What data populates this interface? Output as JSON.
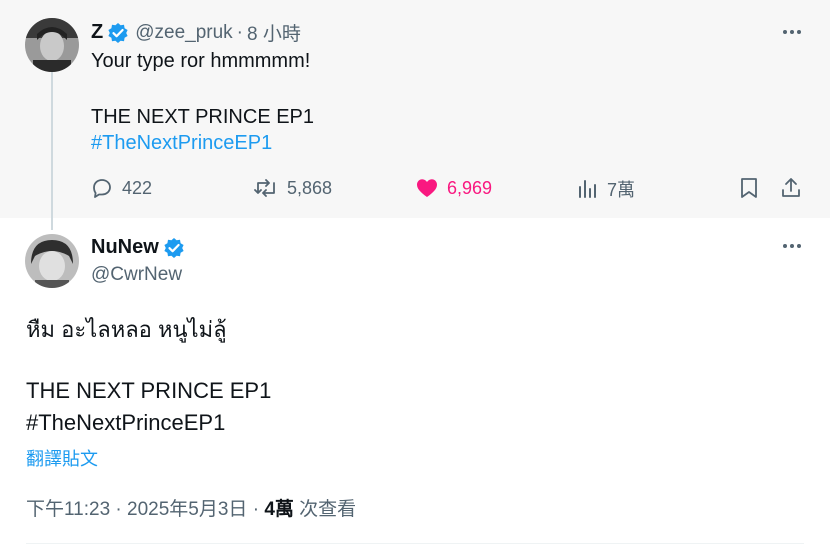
{
  "parent_tweet": {
    "author_name": "Z",
    "handle": "@zee_pruk",
    "separator": "·",
    "time": "8 小時",
    "line1": "Your type ror hmmmmm!",
    "line2": "THE NEXT PRINCE EP1",
    "hashtag": "#TheNextPrinceEP1",
    "stats": {
      "replies": "422",
      "reposts": "5,868",
      "likes": "6,969",
      "views": "7萬"
    }
  },
  "main_tweet": {
    "author_name": "NuNew",
    "handle": "@CwrNew",
    "line1": "หืม อะไลหลอ หนูไม่ลู้",
    "line2": "THE NEXT PRINCE EP1",
    "hashtag": "#TheNextPrinceEP1",
    "translate": "翻譯貼文",
    "timestamp": "下午11:23 · 2025年5月3日 ·",
    "views_count": "4萬",
    "views_label": "次查看"
  },
  "colors": {
    "accent": "#1d9bf0",
    "like": "#f91880",
    "muted": "#536471",
    "verified": "#1d9bf0"
  },
  "icons": [
    "verified-badge-icon",
    "more-icon",
    "reply-icon",
    "repost-icon",
    "like-icon",
    "views-icon",
    "bookmark-icon",
    "share-icon"
  ]
}
